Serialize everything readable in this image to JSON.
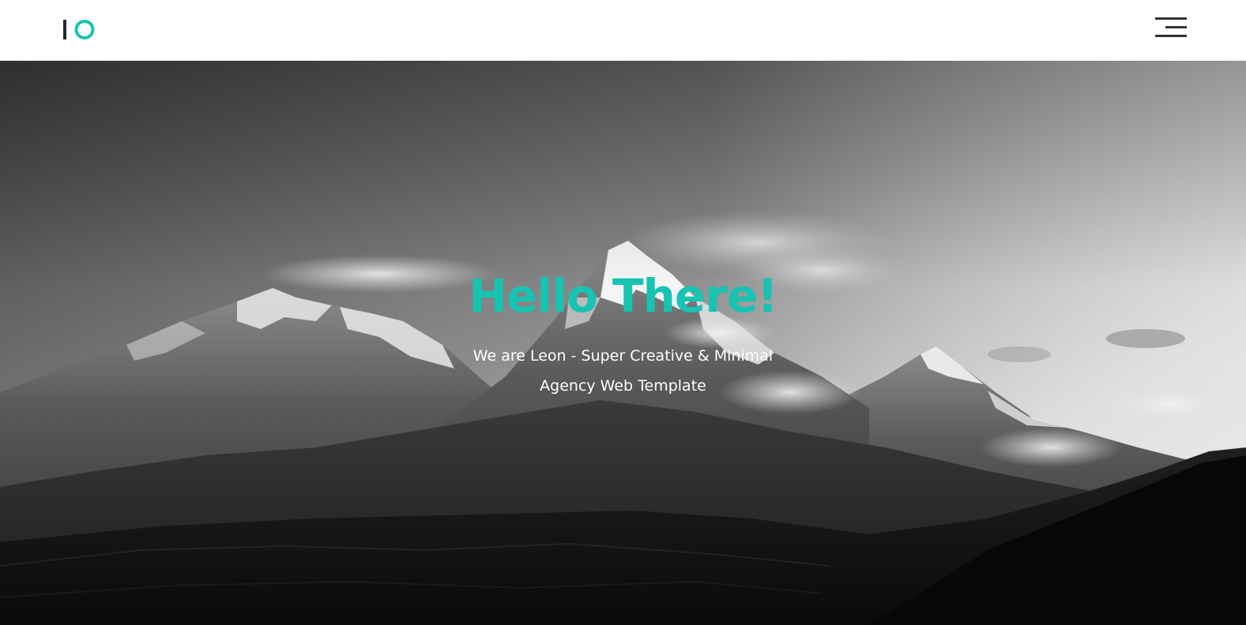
{
  "header": {
    "logo_letters": "IO",
    "menu_icon": "hamburger-menu-icon"
  },
  "hero": {
    "title": "Hello There!",
    "subtitle": "We are Leon - Super Creative & Minimal Agency Web Template",
    "background": "black-and-white-mountain-landscape"
  },
  "colors": {
    "accent": "#17c3b2",
    "dark": "#222a30",
    "menu": "#333333",
    "text_light": "#ffffff"
  }
}
